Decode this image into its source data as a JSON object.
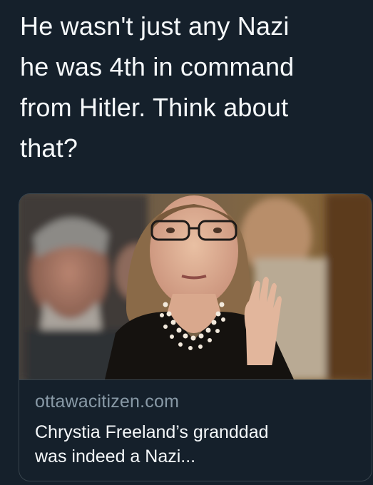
{
  "tweet": {
    "text_lines": [
      "He wasn't just any Nazi",
      "he was 4th in command",
      "from Hitler. Think about",
      "that?"
    ]
  },
  "link_card": {
    "domain": "ottawacitizen.com",
    "title_lines": [
      "Chrystia Freeland’s granddad",
      "was indeed a Nazi..."
    ],
    "image_icon": "news-photo"
  },
  "colors": {
    "background": "#15202b",
    "text": "#f5f8fa",
    "muted": "#8899a6",
    "border": "#38444d"
  }
}
